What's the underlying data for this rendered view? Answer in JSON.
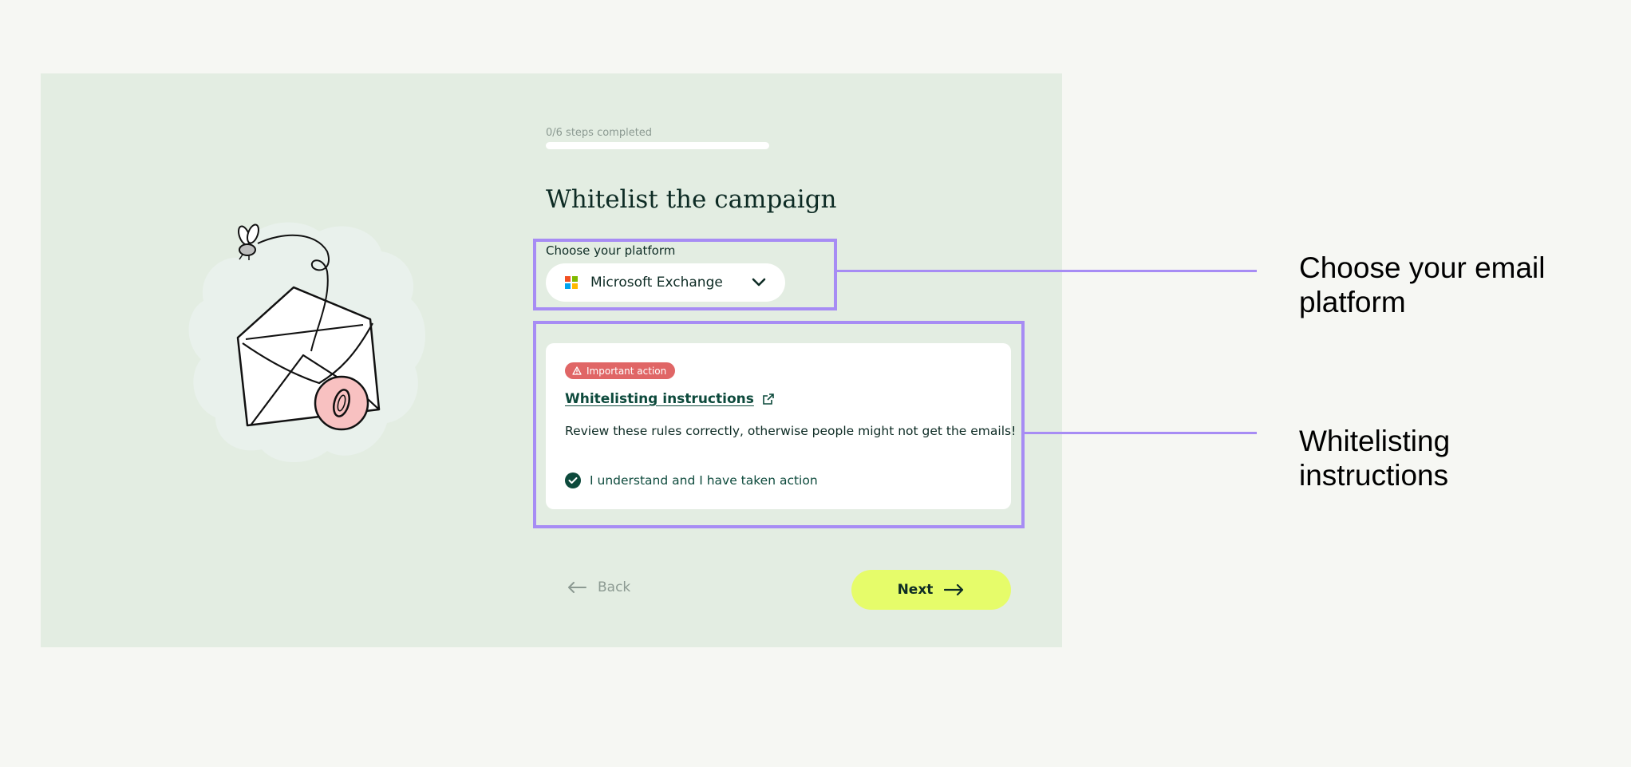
{
  "progress": {
    "label": "0/6 steps completed",
    "completed": 0,
    "total": 6
  },
  "page_title": "Whitelist the campaign",
  "platform": {
    "label": "Choose your platform",
    "selected": "Microsoft Exchange",
    "icon": "microsoft-logo-icon"
  },
  "instructions": {
    "badge": "Important action",
    "link_text": "Whitelisting instructions",
    "body": "Review these rules correctly, otherwise people might not get the emails!",
    "checkbox_label": "I understand and I have taken action",
    "checked": true
  },
  "nav": {
    "back_label": "Back",
    "next_label": "Next"
  },
  "callouts": {
    "platform_line1": "Choose your email",
    "platform_line2": "platform",
    "instructions_line1": "Whitelisting",
    "instructions_line2": "instructions"
  },
  "colors": {
    "panel_bg": "#e3ede2",
    "page_bg": "#f6f7f3",
    "highlight": "#a78cf4",
    "next_button": "#e6fc6a",
    "badge": "#e06666",
    "accent_dark": "#0d4a3c"
  }
}
